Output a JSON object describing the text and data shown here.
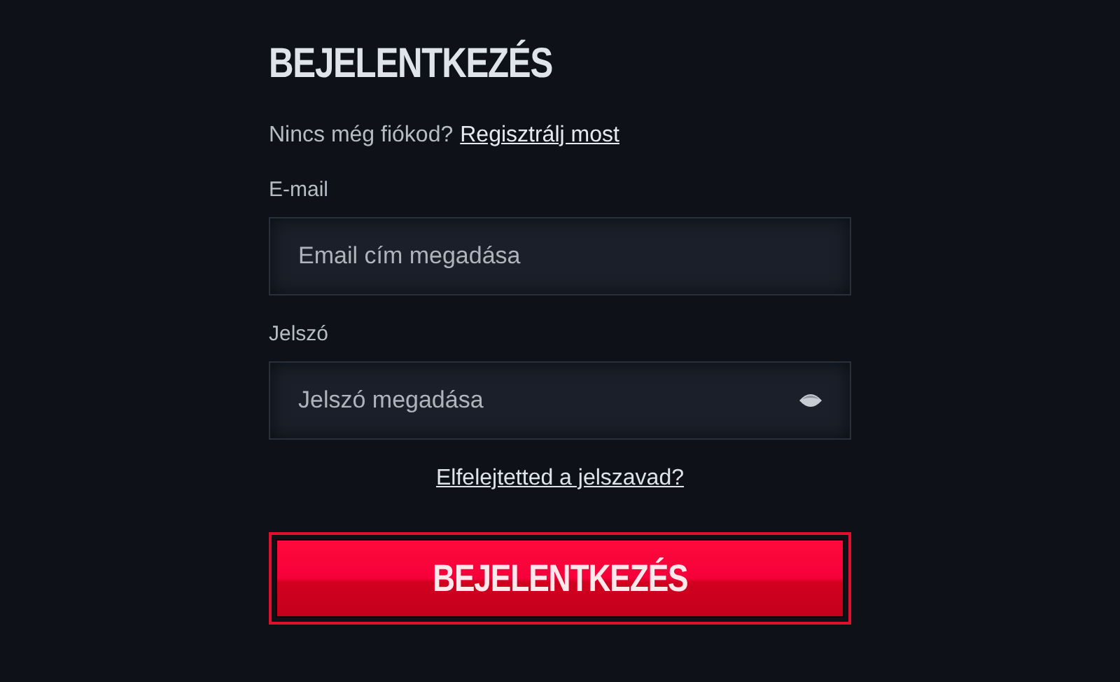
{
  "title": "BEJELENTKEZÉS",
  "signup": {
    "prompt": "Nincs még fiókod?",
    "link": "Regisztrálj most"
  },
  "fields": [
    {
      "label": "E-mail",
      "placeholder": "Email cím megadása",
      "kind": "text"
    },
    {
      "label": "Jelszó",
      "placeholder": "Jelszó megadása",
      "kind": "password"
    }
  ],
  "forgot_link": "Elfelejtetted a jelszavad?",
  "submit_button": "BEJELENTKEZÉS"
}
